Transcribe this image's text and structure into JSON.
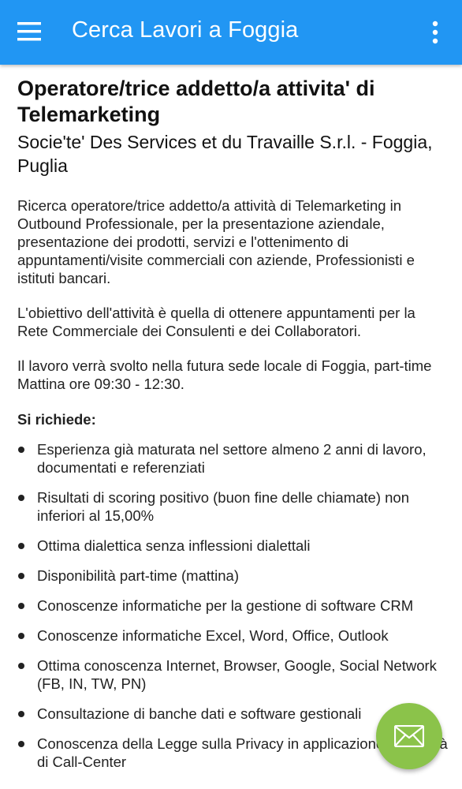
{
  "appbar": {
    "title": "Cerca Lavori a Foggia",
    "color": "#2196f3",
    "menu_icon": "hamburger-menu-icon",
    "overflow_icon": "more-vertical-icon"
  },
  "job": {
    "title": "Operatore/trice addetto/a attivita' di Telemarketing",
    "company": "Socie'te' Des Services et du Travaille S.r.l. - Foggia, Puglia",
    "paragraphs": [
      "Ricerca operatore/trice addetto/a attività di Telemarketing in Outbound Professionale, per la presentazione aziendale, presentazione dei prodotti, servizi e l'ottenimento di appuntamenti/visite commerciali con aziende, Professionisti e istituti bancari.",
      "L'obiettivo dell'attività è quella di ottenere appuntamenti per la Rete Commerciale dei Consulenti e dei Collaboratori.",
      "Il lavoro verrà svolto nella futura sede locale di Foggia, part-time Mattina ore 09:30 - 12:30."
    ],
    "requirements_heading": "Si richiede:",
    "requirements": [
      "Esperienza già maturata nel settore almeno 2 anni di lavoro, documentati e referenziati",
      "Risultati di scoring positivo (buon fine delle chiamate) non inferiori al 15,00%",
      "Ottima dialettica senza inflessioni dialettali",
      "Disponibilità part-time (mattina)",
      "Conoscenze informatiche per la gestione di software CRM",
      "Conoscenze informatiche Excel, Word, Office, Outlook",
      "Ottima conoscenza Internet, Browser, Google, Social Network (FB, IN, TW, PN)",
      "Consultazione di banche dati e software gestionali",
      "Conoscenza della Legge sulla Privacy in applicazione all'attività di Call-Center"
    ]
  },
  "fab": {
    "icon": "envelope-icon",
    "color": "#8bc34a"
  }
}
